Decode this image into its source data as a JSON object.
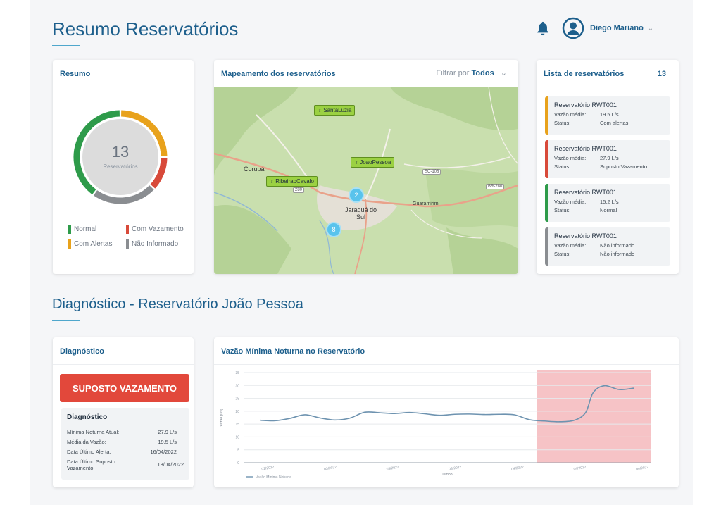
{
  "header": {
    "title": "Resumo Reservatórios",
    "user_name": "Diego Mariano",
    "bell_icon": "bell-icon",
    "avatar_icon": "user-circle-icon",
    "caret": "⌄"
  },
  "summary": {
    "title": "Resumo",
    "total": "13",
    "total_label": "Reservatórios",
    "donut": [
      {
        "status": "normal",
        "fraction": 0.4,
        "color": "#2e9b4a"
      },
      {
        "status": "alertas",
        "fraction": 0.25,
        "color": "#e8a21c"
      },
      {
        "status": "vazamento",
        "fraction": 0.12,
        "color": "#d84a3a"
      },
      {
        "status": "nao_informado",
        "fraction": 0.23,
        "color": "#8a8d91"
      }
    ],
    "legend": [
      {
        "label": "Normal",
        "color": "#2e9b4a"
      },
      {
        "label": "Com Vazamento",
        "color": "#d84a3a"
      },
      {
        "label": "Com Alertas",
        "color": "#e8a21c"
      },
      {
        "label": "Não Informado",
        "color": "#8a8d91"
      }
    ]
  },
  "map": {
    "title": "Mapeamento dos reservatórios",
    "filter_label": "Filtrar por",
    "filter_value": "Todos",
    "filter_caret": "⌄",
    "markers": [
      "SantaLuzia",
      "JoaoPessoa",
      "RibeiraoCavalo"
    ],
    "clusters": [
      "2",
      "8"
    ],
    "cities": [
      "Jaraguá do",
      "Sul",
      "Corupá",
      "Guaramirim"
    ],
    "roads": [
      "SC-108",
      "BR-280",
      "280"
    ]
  },
  "list": {
    "title": "Lista de reservatórios",
    "count": "13",
    "flow_label": "Vazão média:",
    "status_label": "Status:",
    "items": [
      {
        "name": "Reservatório RWT001",
        "flow": "19.5 L/s",
        "status": "Com alertas",
        "color": "#e8a21c"
      },
      {
        "name": "Reservatório RWT001",
        "flow": "27.9 L/s",
        "status": "Suposto Vazamento",
        "color": "#d84a3a"
      },
      {
        "name": "Reservatório RWT001",
        "flow": "15.2 L/s",
        "status": "Normal",
        "color": "#2e9b4a"
      },
      {
        "name": "Reservatório RWT001",
        "flow": "Não informado",
        "status": "Não informado",
        "color": "#8a8d91"
      }
    ]
  },
  "diag_section": {
    "title": "Diagnóstico - Reservatório João Pessoa"
  },
  "diagnosis": {
    "title": "Diagnóstico",
    "alert": "SUPOSTO VAZAMENTO",
    "box_title": "Diagnóstico",
    "rows": [
      {
        "label": "Mínima Noturna Atual:",
        "value": "27.9 L/s"
      },
      {
        "label": "Média da Vazão:",
        "value": "19.5 L/s"
      },
      {
        "label": "Data Último Alerta:",
        "value": "16/04/2022"
      },
      {
        "label": "Data Último Suposto Vazamento:",
        "value": "18/04/2022"
      }
    ]
  },
  "chart_data": {
    "type": "line",
    "title": "Vazão Mínima Noturna no Reservatório",
    "xlabel": "Tempo",
    "ylabel": "Vazão (L/s)",
    "ylim": [
      0,
      35
    ],
    "yticks": [
      0,
      5,
      10,
      15,
      20,
      25,
      30,
      35
    ],
    "x_ticklabels": [
      "02/2022",
      "03/2022",
      "03/2022",
      "03/2022",
      "04/2022",
      "04/2022",
      "04/2022"
    ],
    "highlight_range": [
      0.72,
      1.0
    ],
    "highlight_color": "#f6c3c6",
    "series": [
      {
        "name": "Vazão Mínima Noturna",
        "color": "#6e93b0",
        "x": [
          0,
          0.04,
          0.08,
          0.12,
          0.16,
          0.2,
          0.24,
          0.28,
          0.32,
          0.36,
          0.4,
          0.44,
          0.48,
          0.52,
          0.56,
          0.6,
          0.64,
          0.68,
          0.72,
          0.76,
          0.8,
          0.84,
          0.87,
          0.89,
          0.92,
          0.96,
          1.0
        ],
        "values": [
          16.5,
          16.3,
          17.2,
          18.6,
          17.4,
          16.6,
          17.3,
          19.6,
          19.4,
          19.1,
          19.5,
          19.0,
          18.4,
          18.8,
          18.9,
          18.7,
          18.8,
          18.6,
          16.7,
          16.2,
          15.9,
          16.5,
          19.5,
          27.2,
          29.9,
          28.4,
          29.0
        ]
      }
    ]
  }
}
